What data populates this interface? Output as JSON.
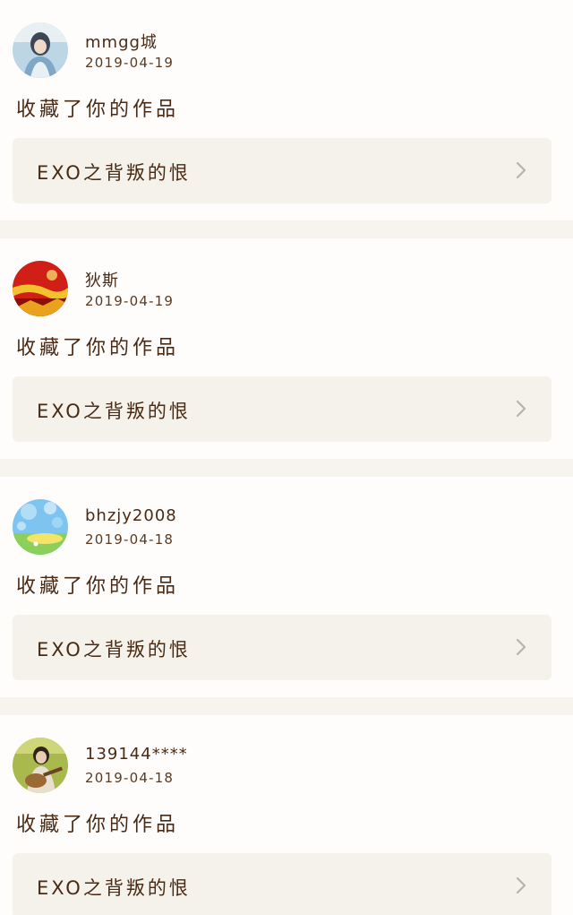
{
  "feed": {
    "items": [
      {
        "username": "mmgg城",
        "date": "2019-04-19",
        "action": "收藏了你的作品",
        "work_title": "EXO之背叛的恨",
        "avatar_icon": "user-photo-avatar-icon",
        "avatar_colors": [
          "#bcd6e6",
          "#3d4654",
          "#e8f0f4"
        ]
      },
      {
        "username": "狄斯",
        "date": "2019-04-19",
        "action": "收藏了你的作品",
        "work_title": "EXO之背叛的恨",
        "avatar_icon": "new-year-greeting-avatar-icon",
        "avatar_colors": [
          "#d01f17",
          "#f2c22e",
          "#8b0f0a"
        ]
      },
      {
        "username": "bhzjy2008",
        "date": "2019-04-18",
        "action": "收藏了你的作品",
        "work_title": "EXO之背叛的恨",
        "avatar_icon": "bokeh-landscape-avatar-icon",
        "avatar_colors": [
          "#7ec4f0",
          "#8ccf5a",
          "#f3e46a"
        ]
      },
      {
        "username": "139144****",
        "date": "2019-04-18",
        "action": "收藏了你的作品",
        "work_title": "EXO之背叛的恨",
        "avatar_icon": "guitar-player-avatar-icon",
        "avatar_colors": [
          "#a9b94e",
          "#2e2419",
          "#e7e0cf"
        ]
      }
    ]
  },
  "colors": {
    "background": "#f7f4ee",
    "card": "#fefdfb",
    "work_box": "#f4f2ea",
    "text": "#4a2a14",
    "chevron": "#b8b4ad"
  }
}
